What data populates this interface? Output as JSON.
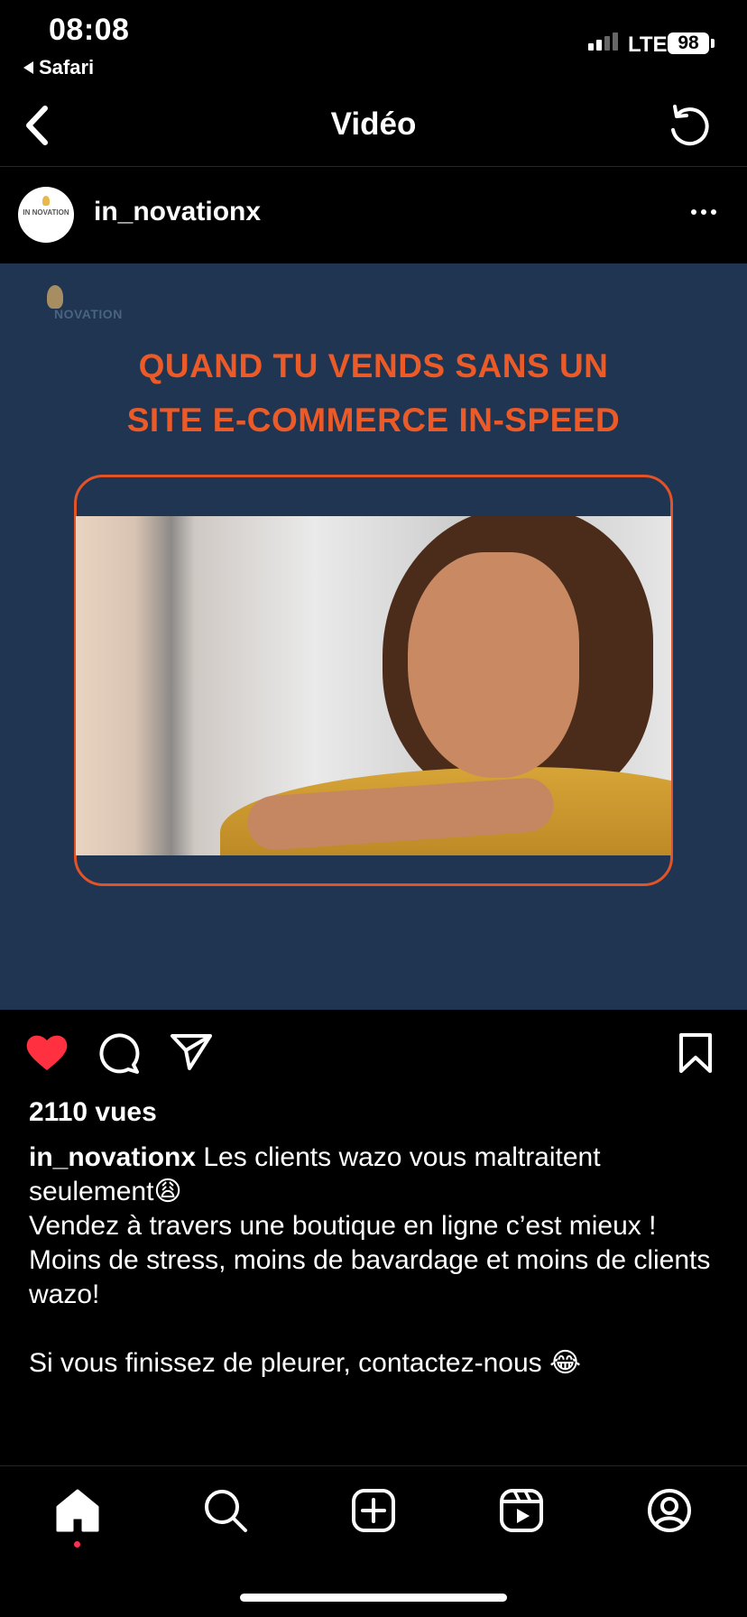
{
  "status_bar": {
    "time": "08:08",
    "back_app": "Safari",
    "network": "LTE",
    "battery": "98"
  },
  "header": {
    "title": "Vidéo",
    "back_icon": "chevron-left-icon",
    "refresh_icon": "refresh-icon"
  },
  "post": {
    "username": "in_novationx",
    "avatar_text": "IN NOVATION",
    "video": {
      "logo_text": "NOVATION",
      "headline_line1": "QUAND TU VENDS SANS UN",
      "headline_line2": "SITE E-COMMERCE IN-SPEED",
      "accent_color": "#ec5a28",
      "background_color": "#1f3552",
      "muted": true
    },
    "liked": true,
    "like_color": "#ff3040",
    "views": "2110 vues",
    "caption": {
      "user": "in_novationx",
      "line1": " Les clients wazo vous maltraitent seulement😩",
      "line2": "Vendez à travers une boutique en ligne c’est mieux !",
      "line3": "Moins de stress, moins de bavardage et moins de clients wazo!",
      "line4": "Si vous finissez de pleurer, contactez-nous 😂"
    }
  },
  "tabbar": {
    "items": [
      "home-icon",
      "search-icon",
      "create-icon",
      "reels-icon",
      "profile-icon"
    ],
    "active": "home-icon"
  }
}
